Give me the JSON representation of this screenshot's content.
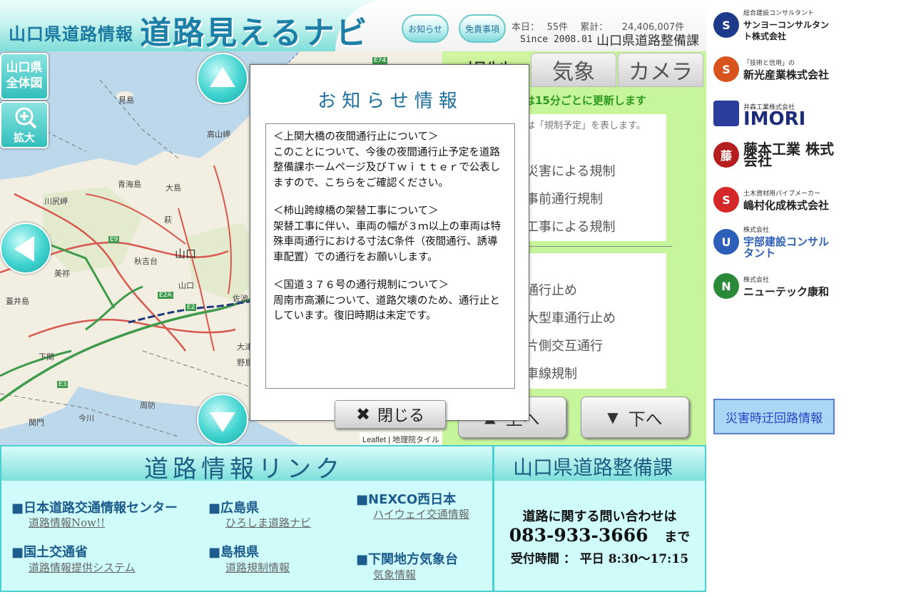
{
  "header": {
    "title_small": "山口県道路情報",
    "title_big": "道路見えるナビ",
    "notice_button": "お知らせ",
    "disclaimer_button": "免責事項",
    "stats": "本日：　 55件　 累計：　　24,406,007件",
    "since": "Since 2008.01",
    "department": "山口県道路整備課"
  },
  "map": {
    "overview_button": "山口県\n全体図",
    "zoom_button": "拡大",
    "attribution_leaflet": "Leaflet",
    "attribution_separator": " | ",
    "attribution_gsi": "地理院タイル",
    "place_labels": [
      "見島",
      "高山岬",
      "大島",
      "青海島",
      "川尻岬",
      "萩",
      "山口",
      "秋吉台",
      "美祢",
      "山口",
      "佐波",
      "下関",
      "大津",
      "周防",
      "今川",
      "野島",
      "蓋井島",
      "関門",
      "E74",
      "E9",
      "E2A",
      "E2",
      "E3"
    ]
  },
  "panel": {
    "tabs": [
      "規制",
      "気象",
      "カメラ"
    ],
    "update_note": "像は15分ごとに更新します",
    "legend_note": "は「規制予定」を表します。",
    "legend_group1": [
      "災害による規制",
      "事前通行規制",
      "工事による規制"
    ],
    "legend_group2": [
      "通行止め",
      "大型車通行止め",
      "片側交互通行",
      "車線規制"
    ],
    "up_button": "上へ",
    "down_button": "下へ"
  },
  "modal": {
    "title": "お知らせ情報",
    "items": [
      {
        "heading": "＜上関大橋の夜間通行止について＞",
        "body": "このことについて、今後の夜間通行止予定を道路整備課ホームページ及びＴｗｉｔｔｅｒで公表しますので、こちらをご確認ください。"
      },
      {
        "heading": "＜柿山跨線橋の架替工事について＞",
        "body": "架替工事に伴い、車両の幅が３ｍ以上の車両は特殊車両通行における寸法C条件（夜間通行、誘導車配置）での通行をお願いします。"
      },
      {
        "heading": "＜国道３７６号の通行規制について＞",
        "body": "周南市高瀬について、道路欠壊のため、通行止としています。復旧時期は未定です。"
      }
    ],
    "close_button": "閉じる"
  },
  "sponsors": [
    {
      "small": "総合建設コンサルタント",
      "name": "サンヨーコンサルタント株式会社",
      "mark": "S",
      "color": "#1d3a8a"
    },
    {
      "small": "「技術と信用」の",
      "name": "新光産業株式会社",
      "mark": "S",
      "color": "#d9531e"
    },
    {
      "small": "井森工業株式会社",
      "name": "IMORI",
      "mark": "",
      "color": "#2a3c9c"
    },
    {
      "small": "",
      "name": "藤本工業 株式会社",
      "mark": "藤",
      "color": "#b41e1e"
    },
    {
      "small": "土木資材用パイプメーカー",
      "name": "嶋村化成株式会社",
      "mark": "S",
      "color": "#d42828"
    },
    {
      "small": "株式会社",
      "name": "宇部建設コンサルタント",
      "mark": "U",
      "color": "#2e5fb8"
    },
    {
      "small": "株式会社",
      "name": "ニューテック康和",
      "mark": "N",
      "color": "#2b8a3a"
    }
  ],
  "disaster_button": "災害時迂回路情報",
  "links": {
    "header": "道路情報リンク",
    "items": [
      {
        "title": "■日本道路交通情報センター",
        "link": "道路情報Now!!"
      },
      {
        "title": "■国土交通省",
        "link": "道路情報提供システム"
      },
      {
        "title": "■広島県",
        "link": "ひろしま道路ナビ"
      },
      {
        "title": "■島根県",
        "link": "道路規制情報"
      },
      {
        "title": "■NEXCO西日本",
        "link": "ハイウェイ交通情報"
      },
      {
        "title": "■下関地方気象台",
        "link": "気象情報"
      }
    ]
  },
  "contact": {
    "header": "山口県道路整備課",
    "line1": "道路に関する問い合わせは",
    "phone": "083-933-3666",
    "phone_suffix": "まで",
    "hours": "受付時間 ： 平日 8:30～17:15"
  }
}
